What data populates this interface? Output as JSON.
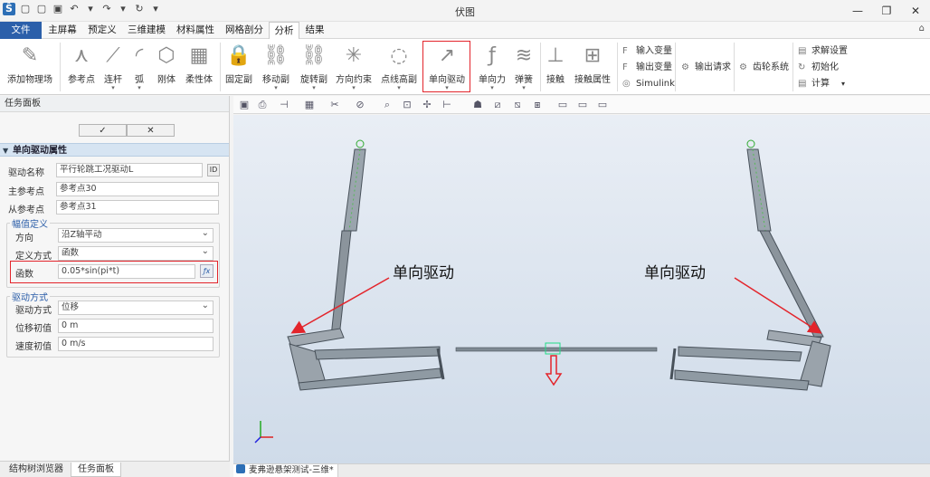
{
  "window": {
    "title": "伏图",
    "controls": [
      "—",
      "❐",
      "✕"
    ]
  },
  "quick_access": [
    "▢",
    "▢",
    "▣",
    "↶",
    "▾",
    "↷",
    "▾",
    "↻",
    "▾"
  ],
  "menu": {
    "file": "文件",
    "items": [
      "主屏幕",
      "预定义",
      "三维建模",
      "材料属性",
      "网格剖分",
      "分析",
      "结果"
    ],
    "active_index": 5,
    "help_icon": "⌂"
  },
  "ribbon": {
    "big_buttons": [
      {
        "label": "添加物理场",
        "icon": "✎",
        "dd": ""
      },
      {
        "label": "参考点",
        "icon": "⋏",
        "dd": ""
      },
      {
        "label": "连杆",
        "icon": "⟋",
        "dd": "▾"
      },
      {
        "label": "弧",
        "icon": "◜",
        "dd": "▾"
      },
      {
        "label": "刚体",
        "icon": "⬡",
        "dd": ""
      },
      {
        "label": "柔性体",
        "icon": "▦",
        "dd": ""
      },
      {
        "label": "固定副",
        "icon": "🔒",
        "dd": ""
      },
      {
        "label": "移动副",
        "icon": "⛓",
        "dd": "▾"
      },
      {
        "label": "旋转副",
        "icon": "⛓",
        "dd": "▾"
      },
      {
        "label": "方向约束",
        "icon": "✳",
        "dd": "▾"
      },
      {
        "label": "点线高副",
        "icon": "◌",
        "dd": "▾"
      },
      {
        "label": "单向驱动",
        "icon": "↗",
        "dd": "▾"
      },
      {
        "label": "单向力",
        "icon": "ƒ",
        "dd": "▾"
      },
      {
        "label": "弹簧",
        "icon": "≋",
        "dd": "▾"
      },
      {
        "label": "接触",
        "icon": "⊥",
        "dd": ""
      },
      {
        "label": "接触属性",
        "icon": "⊞",
        "dd": ""
      }
    ],
    "small_buttons": [
      {
        "label": "输入变量",
        "icon": "F"
      },
      {
        "label": "输出变量",
        "icon": "F"
      },
      {
        "label": "Simulink",
        "icon": "◎"
      },
      {
        "label": "输出请求",
        "icon": "⚙"
      },
      {
        "label": "齿轮系统",
        "icon": "⚙"
      },
      {
        "label": "求解设置",
        "icon": "▤"
      },
      {
        "label": "初始化",
        "icon": "↻"
      },
      {
        "label": "计算",
        "icon": "▤"
      },
      {
        "label": "▾",
        "icon": ""
      }
    ]
  },
  "task_panel": {
    "title": "任务面板",
    "ok": "✓",
    "cancel": "✕",
    "section_toggle": "▼",
    "section_title": "单向驱动属性",
    "drive_name_label": "驱动名称",
    "drive_name_value": "平行轮跳工况驱动L",
    "id_button": "ID",
    "main_ref_label": "主参考点",
    "main_ref_value": "参考点30",
    "sub_ref_label": "从参考点",
    "sub_ref_value": "参考点31",
    "amp_group": "幅值定义",
    "direction_label": "方向",
    "direction_value": "沿Z轴平动",
    "define_label": "定义方式",
    "define_value": "函数",
    "function_label": "函数",
    "function_value": "0.05*sin(pi*t)",
    "fx_button": "ƒx",
    "mode_group": "驱动方式",
    "mode_label": "驱动方式",
    "mode_value": "位移",
    "init_disp_label": "位移初值",
    "init_disp_value": "0 m",
    "init_vel_label": "速度初值",
    "init_vel_value": "0 m/s",
    "bottom_tabs": [
      "结构树浏览器",
      "任务面板"
    ]
  },
  "view_toolbar": [
    "▣",
    "⎙",
    "⊣",
    "▦",
    "✂",
    "⊘",
    "⌕",
    "⊡",
    "✢",
    "⊢",
    "☗",
    "⧄",
    "⧅",
    "⧆",
    "▭",
    "▭",
    "▭"
  ],
  "viewport": {
    "annotation_left": "单向驱动",
    "annotation_right": "单向驱动",
    "tab_label": "麦弗逊悬架测试-三维*",
    "accent_red": "#e3242b"
  }
}
